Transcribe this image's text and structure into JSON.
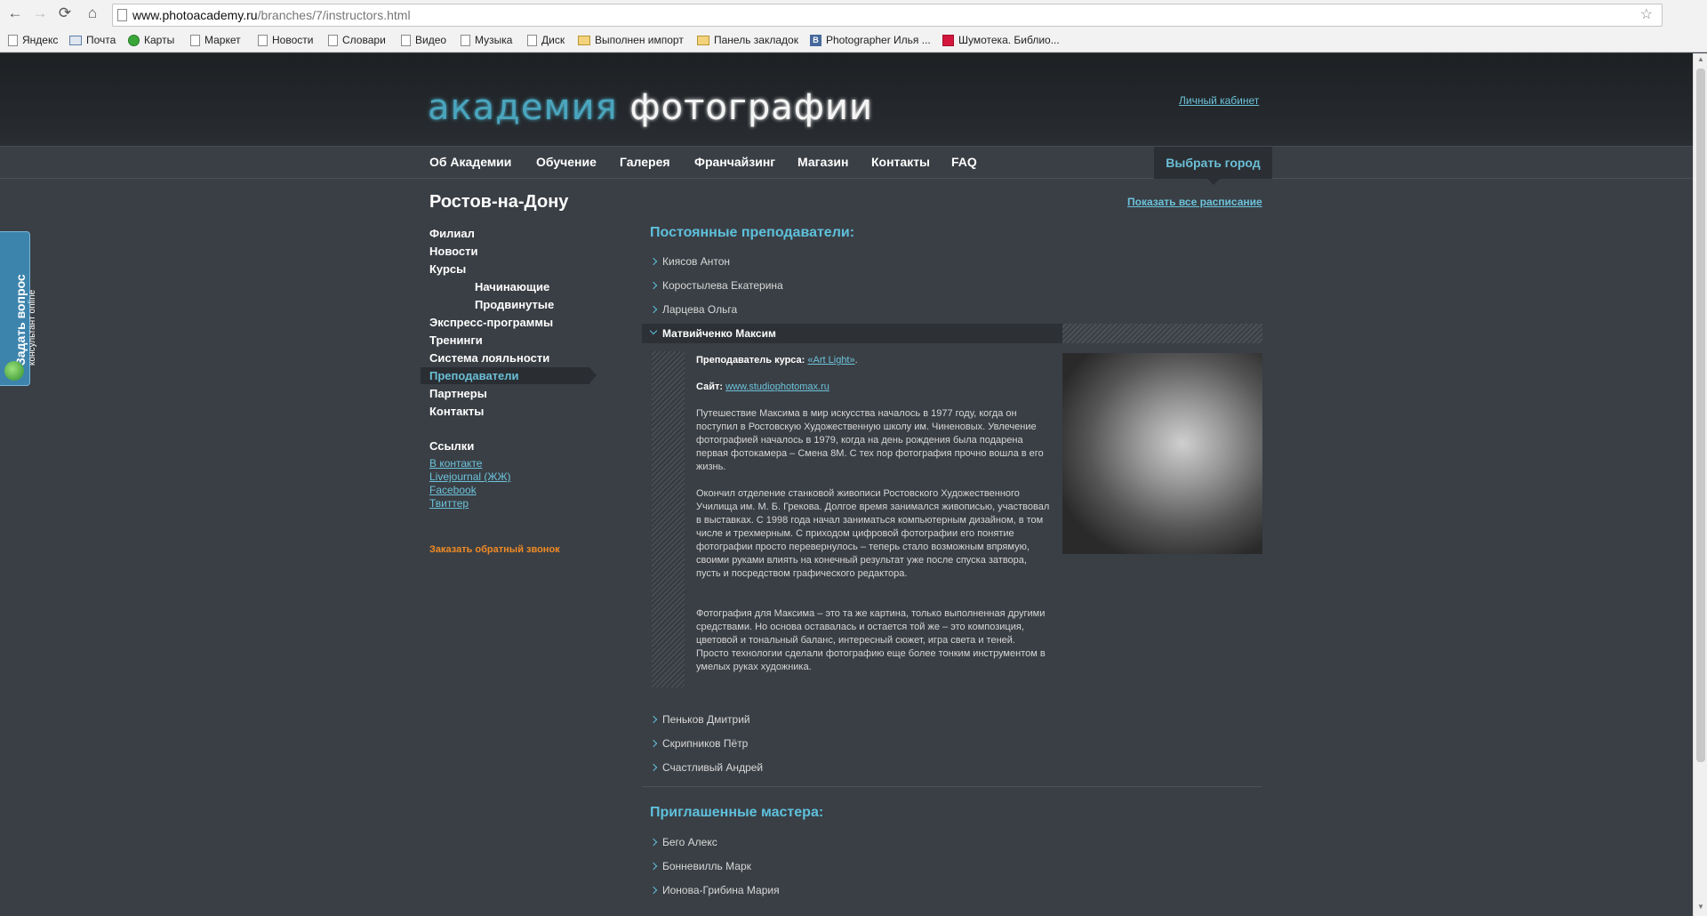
{
  "browser": {
    "url_domain": "www.photoacademy.ru",
    "url_path": "/branches/7/instructors.html",
    "bookmarks": [
      "Яндекс",
      "Почта",
      "Карты",
      "Маркет",
      "Новости",
      "Словари",
      "Видео",
      "Музыка",
      "Диск",
      "Выполнен импорт",
      "Панель закладок",
      "Photographer Илья ...",
      "Шумотека. Библио..."
    ]
  },
  "header": {
    "logo_part1": "академия",
    "logo_part2": "фотографии",
    "cabinet_link": "Личный кабинет"
  },
  "nav": {
    "items": [
      "Об Академии",
      "Обучение",
      "Галерея",
      "Франчайзинг",
      "Магазин",
      "Контакты",
      "FAQ"
    ],
    "city_button": "Выбрать город"
  },
  "page": {
    "city": "Ростов-на-Дону",
    "schedule_link": "Показать все расписание"
  },
  "sidebar": {
    "items": [
      "Филиал",
      "Новости",
      "Курсы",
      "Начинающие",
      "Продвинутые",
      "Экспресс-программы",
      "Тренинги",
      "Система лояльности",
      "Преподаватели",
      "Партнеры",
      "Контакты"
    ],
    "active": "Преподаватели",
    "links_title": "Ссылки",
    "links": [
      "В контакте",
      "Livejournal (ЖЖ)",
      "Facebook",
      "Твиттер"
    ],
    "callback": "Заказать обратный звонок"
  },
  "teachers": {
    "title": "Постоянные преподаватели:",
    "list_before": [
      "Киясов Антон",
      "Коростылева Екатерина",
      "Ларцева Ольга"
    ],
    "expanded": {
      "name": "Матвийченко Максим",
      "course_label": "Преподаватель курса: ",
      "course_link": "«Art Light»",
      "course_suffix": ".",
      "site_label": "Сайт: ",
      "site_link": "www.studiophotomax.ru",
      "bio": [
        "Путешествие Максима в мир искусства началось в 1977 году, когда он поступил в Ростовскую Художественную школу им. Чиненовых. Увлечение фотографией началось в 1979, когда на день рождения была подарена первая фотокамера – Смена 8М. С тех пор фотография прочно вошла в его  жизнь.",
        "Окончил отделение станковой живописи Ростовского Художественного Училища им. М. Б. Грекова. Долгое время занимался живописью, участвовал в выставках. С 1998 года начал заниматься компьютерным дизайном, в том числе и трехмерным. С приходом цифровой фотографии его понятие фотографии просто перевернулось – теперь стало возможным впрямую, своими руками влиять на конечный результат уже после спуска затвора, пусть и посредством графического редактора.",
        "Фотография для  Максима – это та же картина, только выполненная другими средствами. Но основа оставалась и остается той же – это композиция, цветовой и тональный баланс, интересный сюжет, игра света и теней. Просто технологии сделали фотографию еще более тонким инструментом в умелых руках художника."
      ]
    },
    "list_after": [
      "Пеньков Дмитрий",
      "Скрипников Пётр",
      "Счастливый Андрей"
    ]
  },
  "masters": {
    "title": "Приглашенные мастера:",
    "list": [
      "Бего Алекс",
      "Бонневилль Марк",
      "Ионова-Грибина Мария"
    ]
  },
  "widget": {
    "title": "Задать вопрос",
    "subtitle": "консультант online"
  }
}
